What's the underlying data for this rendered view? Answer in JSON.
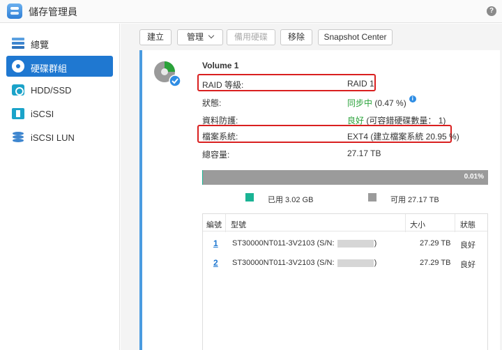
{
  "app": {
    "title": "儲存管理員",
    "help_icon": "?"
  },
  "sidebar": {
    "items": [
      {
        "label": "總覽",
        "icon": "overview-icon"
      },
      {
        "label": "硬碟群組",
        "icon": "raid-disk-icon",
        "active": true
      },
      {
        "label": "HDD/SSD",
        "icon": "hdd-icon"
      },
      {
        "label": "iSCSI",
        "icon": "iscsi-icon"
      },
      {
        "label": "iSCSI LUN",
        "icon": "lun-icon"
      }
    ]
  },
  "toolbar": {
    "create": "建立",
    "manage": "管理",
    "hot_spare": "備用硬碟",
    "remove": "移除",
    "snapshot": "Snapshot Center"
  },
  "volume": {
    "title": "Volume 1",
    "raid_label": "RAID 等級:",
    "raid_value": "RAID 1",
    "status_label": "狀態:",
    "status_value": "同步中",
    "status_progress": "(0.47 %)",
    "protection_label": "資料防護:",
    "protection_value": "良好",
    "protection_extra": "(可容錯硬碟數量： 1)",
    "fs_label": "檔案系統:",
    "fs_value": "EXT4 (建立檔案系統 20.95 %)",
    "capacity_label": "總容量:",
    "capacity_value": "27.17 TB",
    "usage_percent_label": "0.01%",
    "usage_fraction": 0.0001,
    "used_label": "已用 3.02 GB",
    "free_label": "可用 27.17 TB"
  },
  "disk_table": {
    "headers": {
      "num": "編號",
      "model": "型號",
      "size": "大小",
      "status": "狀態"
    },
    "rows": [
      {
        "num": "1",
        "model": "ST30000NT011-3V2103 (S/N:",
        "model_end": ")",
        "size": "27.29 TB",
        "status": "良好"
      },
      {
        "num": "2",
        "model": "ST30000NT011-3V2103 (S/N:",
        "model_end": ")",
        "size": "27.29 TB",
        "status": "良好"
      }
    ]
  },
  "colors": {
    "accent": "#1f78d1",
    "used": "#1ab394",
    "free": "#9b9b9b",
    "highlight": "#d91f1f",
    "ok": "#2aa23a"
  }
}
